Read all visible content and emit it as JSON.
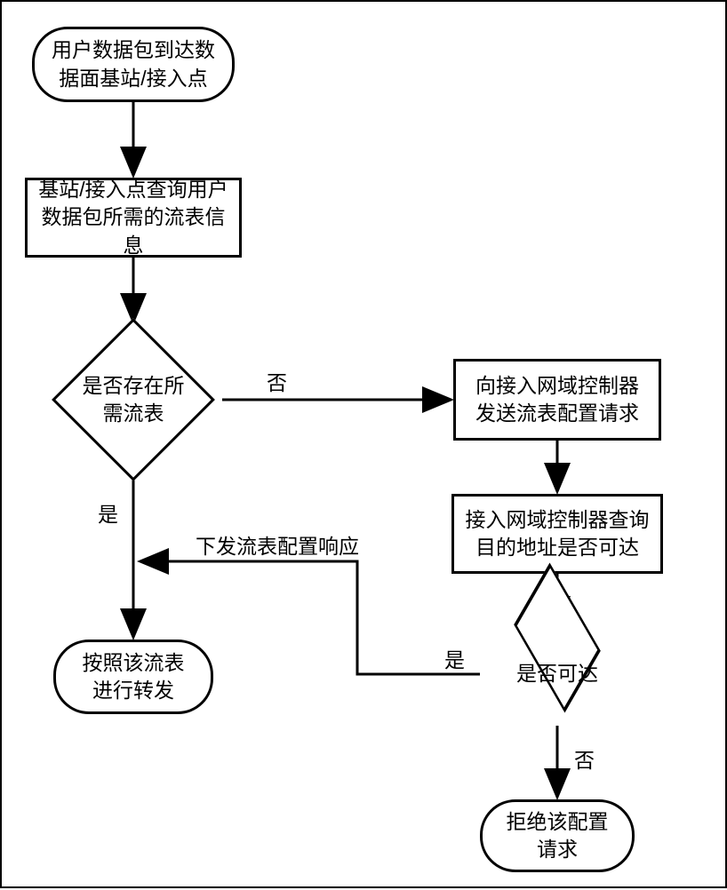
{
  "nodes": {
    "start": "用户数据包到达数\n据面基站/接入点",
    "query": "基站/接入点查询用户\n数据包所需的流表信息",
    "hasFlowTable": "是否存在所\n需流表",
    "forward": "按照该流表\n进行转发",
    "sendReq": "向接入网域控制器\n发送流表配置请求",
    "checkReach": "接入网域控制器查询\n目的地址是否可达",
    "reachable": "是否可达",
    "rejectReq": "拒绝该配置\n请求"
  },
  "edgeLabels": {
    "no1": "否",
    "yes1": "是",
    "respConfig": "下发流表配置响应",
    "yes2": "是",
    "no2": "否"
  }
}
